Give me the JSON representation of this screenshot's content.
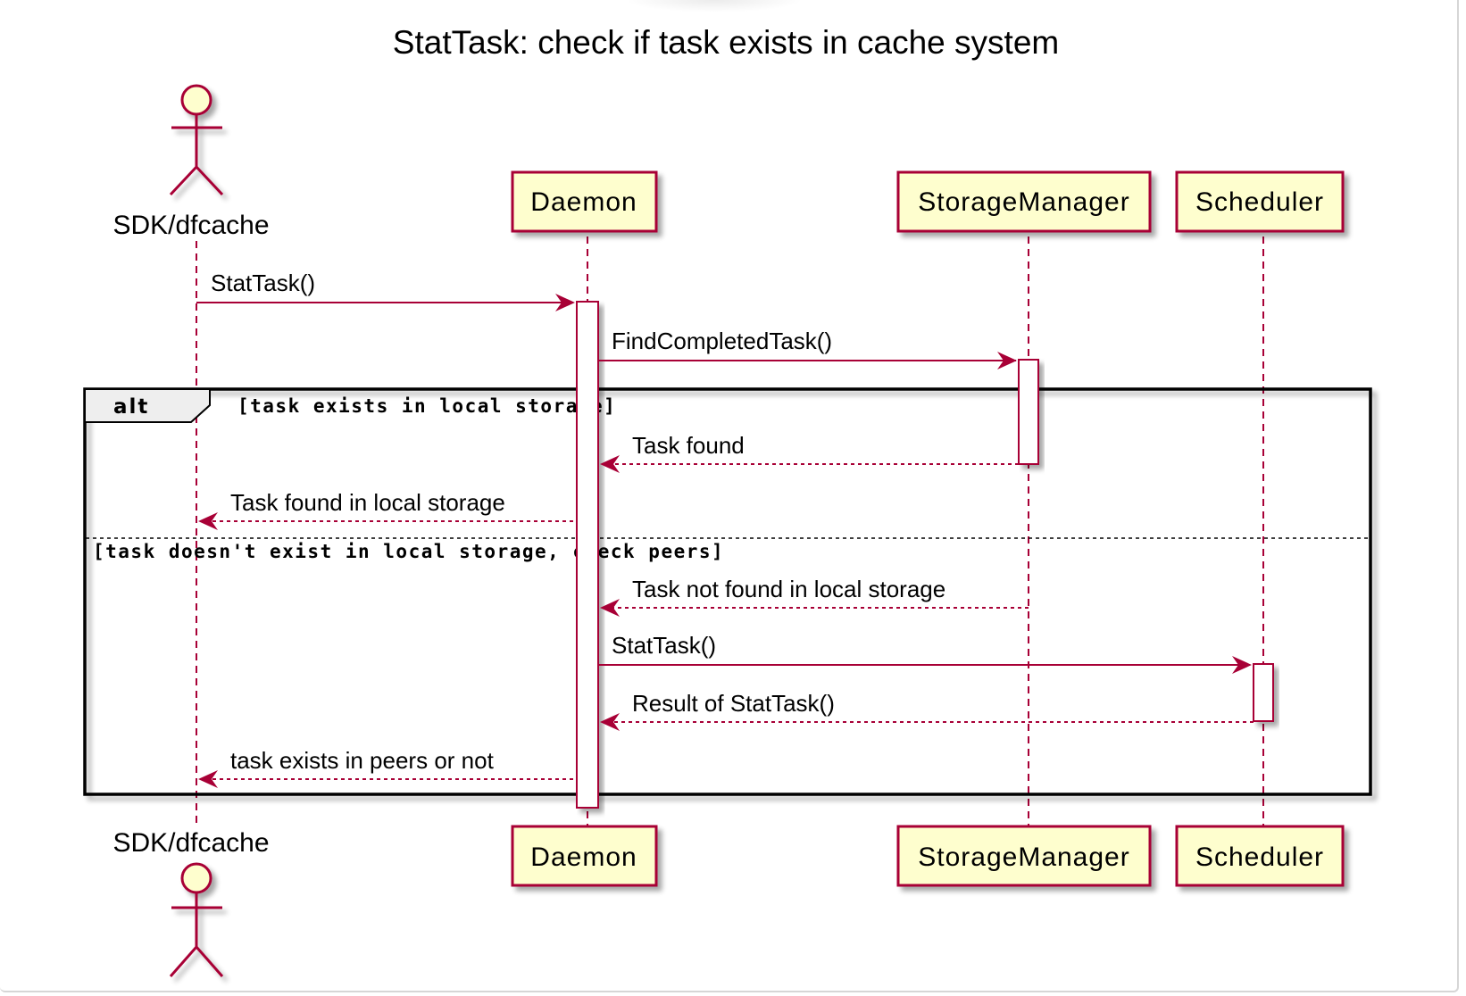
{
  "diagram": {
    "title": "StatTask: check if task exists in cache system",
    "colors": {
      "line": "#a80036",
      "participant_fill": "#fefece",
      "activation_fill": "#ffffff",
      "frame": "#000000",
      "alt_tab_fill": "#eeeeee"
    },
    "participants": [
      {
        "id": "sdk",
        "name": "SDK/dfcache",
        "kind": "actor"
      },
      {
        "id": "daemon",
        "name": "Daemon",
        "kind": "participant"
      },
      {
        "id": "storage",
        "name": "StorageManager",
        "kind": "participant"
      },
      {
        "id": "scheduler",
        "name": "Scheduler",
        "kind": "participant"
      }
    ],
    "messages": [
      {
        "from": "sdk",
        "to": "daemon",
        "label": "StatTask()",
        "style": "solid"
      },
      {
        "from": "daemon",
        "to": "storage",
        "label": "FindCompletedTask()",
        "style": "solid"
      },
      {
        "from": "storage",
        "to": "daemon",
        "label": "Task found",
        "style": "dashed"
      },
      {
        "from": "daemon",
        "to": "sdk",
        "label": "Task found in local storage",
        "style": "dashed"
      },
      {
        "from": "storage",
        "to": "daemon",
        "label": "Task not found in local storage",
        "style": "dashed"
      },
      {
        "from": "daemon",
        "to": "scheduler",
        "label": "StatTask()",
        "style": "solid"
      },
      {
        "from": "scheduler",
        "to": "daemon",
        "label": "Result of StatTask()",
        "style": "dashed"
      },
      {
        "from": "daemon",
        "to": "sdk",
        "label": "task exists in peers or not",
        "style": "dashed"
      }
    ],
    "alt": {
      "keyword": "alt",
      "conditions": [
        "[task exists in local storage]",
        "[task doesn't exist in local storage, check peers]"
      ]
    }
  }
}
